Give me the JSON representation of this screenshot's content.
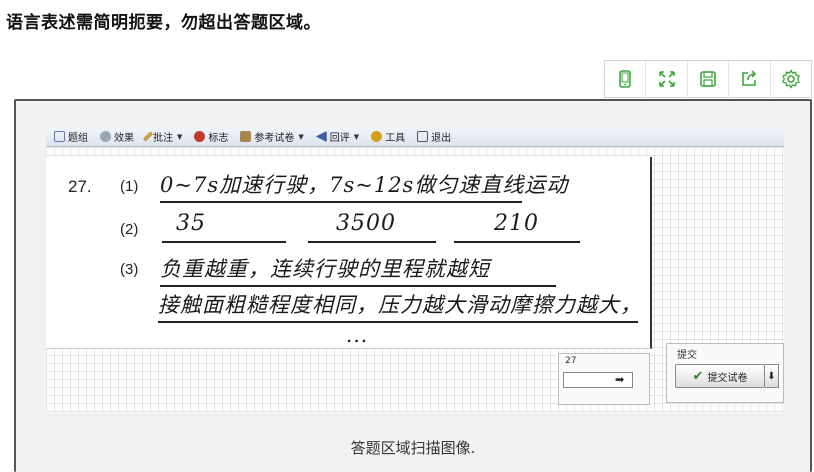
{
  "instruction": "语言表述需简明扼要，勿超出答题区域。",
  "tools": [
    {
      "name": "tablet-icon",
      "color": "#3aa83a"
    },
    {
      "name": "fullscreen-icon",
      "color": "#3aa83a"
    },
    {
      "name": "save-icon",
      "color": "#3aa83a"
    },
    {
      "name": "share-icon",
      "color": "#3aa83a"
    },
    {
      "name": "settings-icon",
      "color": "#3aa83a"
    }
  ],
  "toolbar": {
    "items": [
      {
        "label": "题组",
        "icon": "question-group-icon",
        "color": "#5a7bb5",
        "dropdown": false
      },
      {
        "label": "效果",
        "icon": "effect-icon",
        "color": "#7a7a7a",
        "dropdown": false
      },
      {
        "label": "批注",
        "icon": "pencil-icon",
        "color": "#b08a3a",
        "dropdown": true
      },
      {
        "label": "标志",
        "icon": "mark-icon",
        "color": "#c0392b",
        "dropdown": false
      },
      {
        "label": "参考试卷",
        "icon": "reference-icon",
        "color": "#8a6a2a",
        "dropdown": true
      },
      {
        "label": "回评",
        "icon": "back-review-icon",
        "color": "#3a5fa8",
        "dropdown": true
      },
      {
        "label": "工具",
        "icon": "tool-icon",
        "color": "#d4a017",
        "dropdown": false
      },
      {
        "label": "退出",
        "icon": "exit-icon",
        "color": "#555555",
        "dropdown": false
      }
    ]
  },
  "answer": {
    "question_number": "27.",
    "part1_label": "(1)",
    "part1_text": "0~7s加速行驶，7s~12s做匀速直线运动",
    "part2_label": "(2)",
    "part2_values": [
      "35",
      "3500",
      "210"
    ],
    "part3_label": "(3)",
    "part3_line1": "负重越重，连续行驶的里程就越短",
    "part3_line2": "接触面粗糙程度相同，压力越大滑动摩擦力越大，",
    "part3_line3": "..."
  },
  "score": {
    "label": "27",
    "arrow": "➡"
  },
  "submit": {
    "legend": "提交",
    "button_label": "提交试卷",
    "side_arrow": "⬇"
  },
  "caption": "答题区域扫描图像."
}
